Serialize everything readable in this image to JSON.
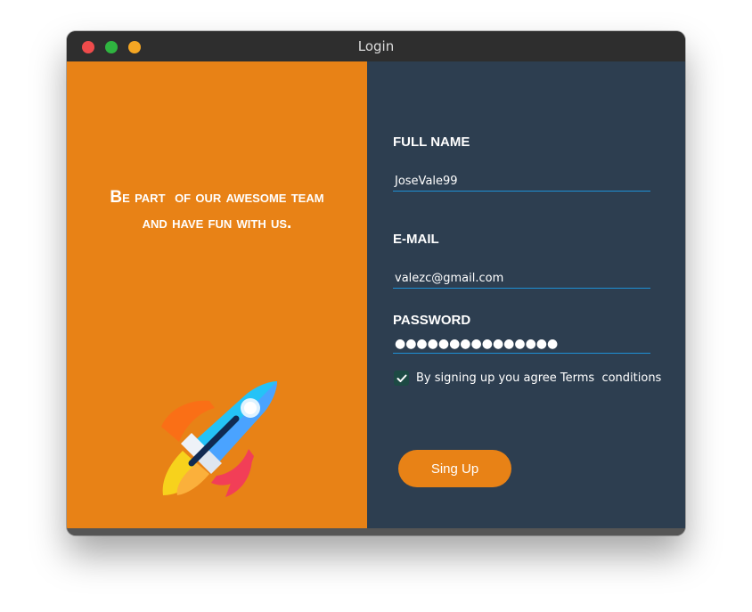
{
  "window": {
    "title": "Login",
    "controls": [
      "close",
      "minimize",
      "maximize"
    ]
  },
  "left_panel": {
    "tagline_line1": "Be part  of our awesome team",
    "tagline_line2": "and have fun with us.",
    "illustration": "rocket-icon",
    "background": "#e88216"
  },
  "form": {
    "full_name": {
      "label": "FULL NAME",
      "value": "JoseVale99"
    },
    "email": {
      "label": "E-MAIL",
      "value": "valezc@gmail.com"
    },
    "password": {
      "label": "PASSWORD",
      "value": "●●●●●●●●●●●●●●●"
    },
    "terms": {
      "checked": true,
      "text": "By signing up you agree Terms  conditions"
    },
    "submit_label": "Sing Up",
    "accent": "#e88216",
    "underline": "#1e90d6",
    "background": "#2d3e50"
  }
}
